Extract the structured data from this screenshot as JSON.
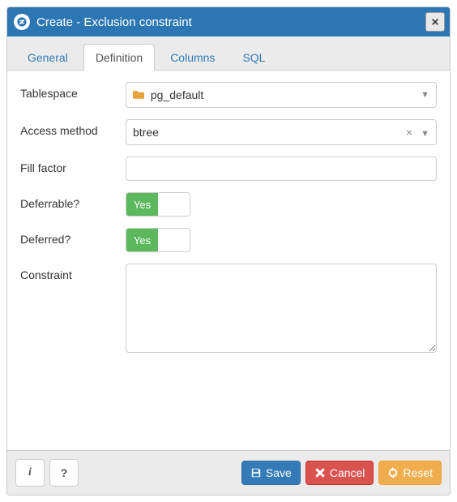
{
  "dialog": {
    "title": "Create - Exclusion constraint"
  },
  "tabs": [
    {
      "label": "General",
      "active": false
    },
    {
      "label": "Definition",
      "active": true
    },
    {
      "label": "Columns",
      "active": false
    },
    {
      "label": "SQL",
      "active": false
    }
  ],
  "form": {
    "tablespace": {
      "label": "Tablespace",
      "value": "pg_default"
    },
    "access_method": {
      "label": "Access method",
      "value": "btree"
    },
    "fill_factor": {
      "label": "Fill factor",
      "value": ""
    },
    "deferrable": {
      "label": "Deferrable?",
      "value": "Yes"
    },
    "deferred": {
      "label": "Deferred?",
      "value": "Yes"
    },
    "constraint": {
      "label": "Constraint",
      "value": ""
    }
  },
  "footer": {
    "info": "i",
    "help": "?",
    "save": "Save",
    "cancel": "Cancel",
    "reset": "Reset"
  }
}
